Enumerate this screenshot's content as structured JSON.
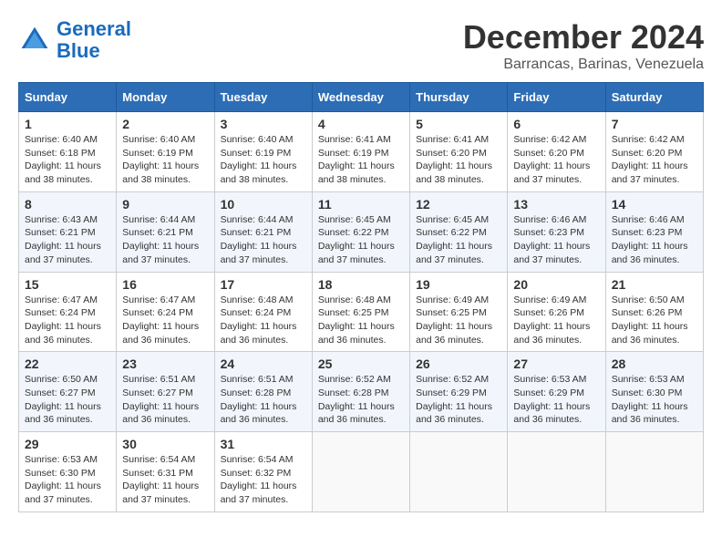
{
  "logo": {
    "text_general": "General",
    "text_blue": "Blue"
  },
  "header": {
    "month": "December 2024",
    "location": "Barrancas, Barinas, Venezuela"
  },
  "days_of_week": [
    "Sunday",
    "Monday",
    "Tuesday",
    "Wednesday",
    "Thursday",
    "Friday",
    "Saturday"
  ],
  "weeks": [
    [
      {
        "day": "1",
        "info": "Sunrise: 6:40 AM\nSunset: 6:18 PM\nDaylight: 11 hours and 38 minutes."
      },
      {
        "day": "2",
        "info": "Sunrise: 6:40 AM\nSunset: 6:19 PM\nDaylight: 11 hours and 38 minutes."
      },
      {
        "day": "3",
        "info": "Sunrise: 6:40 AM\nSunset: 6:19 PM\nDaylight: 11 hours and 38 minutes."
      },
      {
        "day": "4",
        "info": "Sunrise: 6:41 AM\nSunset: 6:19 PM\nDaylight: 11 hours and 38 minutes."
      },
      {
        "day": "5",
        "info": "Sunrise: 6:41 AM\nSunset: 6:20 PM\nDaylight: 11 hours and 38 minutes."
      },
      {
        "day": "6",
        "info": "Sunrise: 6:42 AM\nSunset: 6:20 PM\nDaylight: 11 hours and 37 minutes."
      },
      {
        "day": "7",
        "info": "Sunrise: 6:42 AM\nSunset: 6:20 PM\nDaylight: 11 hours and 37 minutes."
      }
    ],
    [
      {
        "day": "8",
        "info": "Sunrise: 6:43 AM\nSunset: 6:21 PM\nDaylight: 11 hours and 37 minutes."
      },
      {
        "day": "9",
        "info": "Sunrise: 6:44 AM\nSunset: 6:21 PM\nDaylight: 11 hours and 37 minutes."
      },
      {
        "day": "10",
        "info": "Sunrise: 6:44 AM\nSunset: 6:21 PM\nDaylight: 11 hours and 37 minutes."
      },
      {
        "day": "11",
        "info": "Sunrise: 6:45 AM\nSunset: 6:22 PM\nDaylight: 11 hours and 37 minutes."
      },
      {
        "day": "12",
        "info": "Sunrise: 6:45 AM\nSunset: 6:22 PM\nDaylight: 11 hours and 37 minutes."
      },
      {
        "day": "13",
        "info": "Sunrise: 6:46 AM\nSunset: 6:23 PM\nDaylight: 11 hours and 37 minutes."
      },
      {
        "day": "14",
        "info": "Sunrise: 6:46 AM\nSunset: 6:23 PM\nDaylight: 11 hours and 36 minutes."
      }
    ],
    [
      {
        "day": "15",
        "info": "Sunrise: 6:47 AM\nSunset: 6:24 PM\nDaylight: 11 hours and 36 minutes."
      },
      {
        "day": "16",
        "info": "Sunrise: 6:47 AM\nSunset: 6:24 PM\nDaylight: 11 hours and 36 minutes."
      },
      {
        "day": "17",
        "info": "Sunrise: 6:48 AM\nSunset: 6:24 PM\nDaylight: 11 hours and 36 minutes."
      },
      {
        "day": "18",
        "info": "Sunrise: 6:48 AM\nSunset: 6:25 PM\nDaylight: 11 hours and 36 minutes."
      },
      {
        "day": "19",
        "info": "Sunrise: 6:49 AM\nSunset: 6:25 PM\nDaylight: 11 hours and 36 minutes."
      },
      {
        "day": "20",
        "info": "Sunrise: 6:49 AM\nSunset: 6:26 PM\nDaylight: 11 hours and 36 minutes."
      },
      {
        "day": "21",
        "info": "Sunrise: 6:50 AM\nSunset: 6:26 PM\nDaylight: 11 hours and 36 minutes."
      }
    ],
    [
      {
        "day": "22",
        "info": "Sunrise: 6:50 AM\nSunset: 6:27 PM\nDaylight: 11 hours and 36 minutes."
      },
      {
        "day": "23",
        "info": "Sunrise: 6:51 AM\nSunset: 6:27 PM\nDaylight: 11 hours and 36 minutes."
      },
      {
        "day": "24",
        "info": "Sunrise: 6:51 AM\nSunset: 6:28 PM\nDaylight: 11 hours and 36 minutes."
      },
      {
        "day": "25",
        "info": "Sunrise: 6:52 AM\nSunset: 6:28 PM\nDaylight: 11 hours and 36 minutes."
      },
      {
        "day": "26",
        "info": "Sunrise: 6:52 AM\nSunset: 6:29 PM\nDaylight: 11 hours and 36 minutes."
      },
      {
        "day": "27",
        "info": "Sunrise: 6:53 AM\nSunset: 6:29 PM\nDaylight: 11 hours and 36 minutes."
      },
      {
        "day": "28",
        "info": "Sunrise: 6:53 AM\nSunset: 6:30 PM\nDaylight: 11 hours and 36 minutes."
      }
    ],
    [
      {
        "day": "29",
        "info": "Sunrise: 6:53 AM\nSunset: 6:30 PM\nDaylight: 11 hours and 37 minutes."
      },
      {
        "day": "30",
        "info": "Sunrise: 6:54 AM\nSunset: 6:31 PM\nDaylight: 11 hours and 37 minutes."
      },
      {
        "day": "31",
        "info": "Sunrise: 6:54 AM\nSunset: 6:32 PM\nDaylight: 11 hours and 37 minutes."
      },
      null,
      null,
      null,
      null
    ]
  ]
}
